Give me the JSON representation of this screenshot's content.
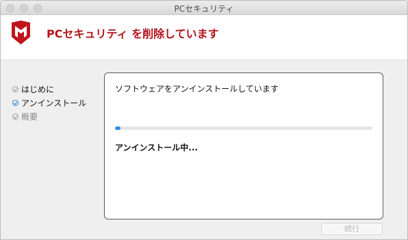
{
  "window": {
    "title": "PCセキュリティ"
  },
  "header": {
    "title": "PCセキュリティ を削除しています",
    "brand_color": "#b3121b",
    "logo_icon": "mcafee-shield-logo"
  },
  "steps": [
    {
      "label": "はじめに",
      "state": "done"
    },
    {
      "label": "アンインストール",
      "state": "active"
    },
    {
      "label": "概要",
      "state": "pending"
    }
  ],
  "panel": {
    "message": "ソフトウェアをアンインストールしています",
    "progress": 0.02,
    "status": "アンインストール中..."
  },
  "buttons": {
    "continue_label": "続行"
  }
}
